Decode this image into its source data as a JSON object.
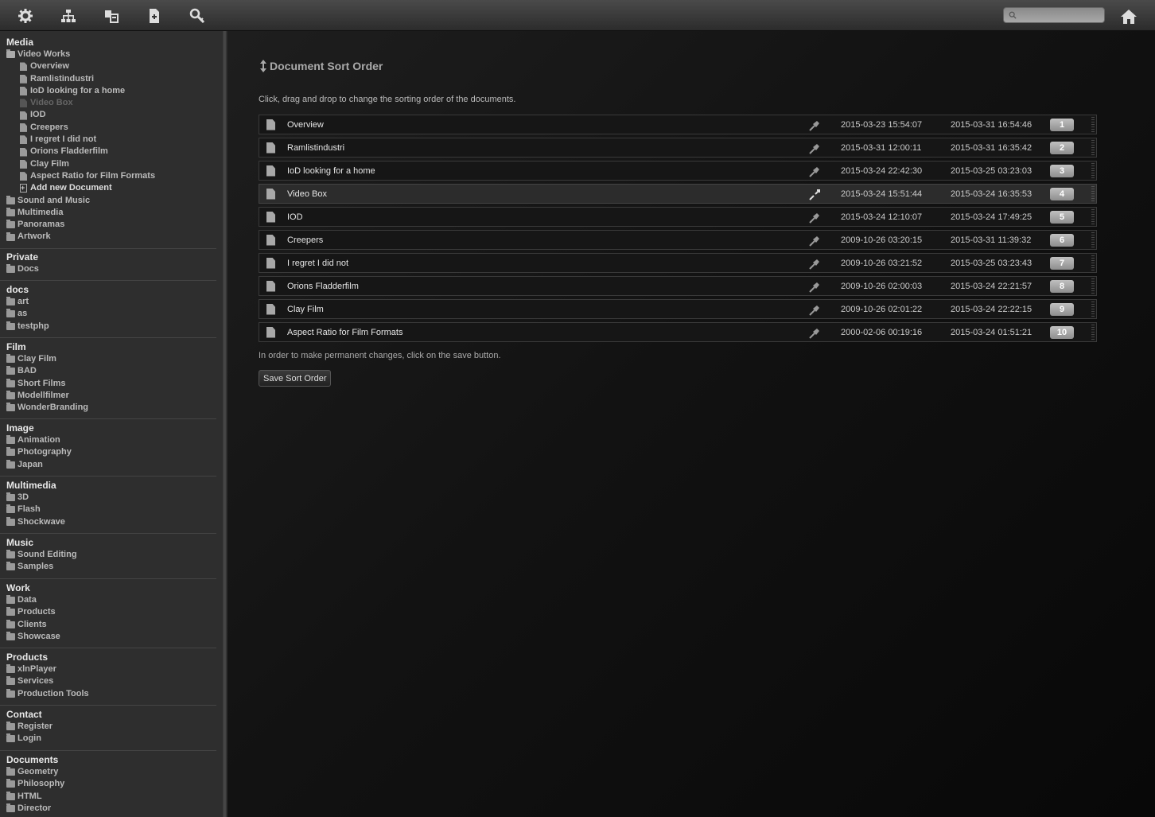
{
  "toolbar": {
    "icons": [
      "gear-icon",
      "sitemap-icon",
      "copy-icon",
      "new-document-icon",
      "search-key-icon"
    ],
    "search_placeholder": "",
    "home_icon": "home-icon"
  },
  "sidebar": {
    "sections": [
      {
        "title": "Media",
        "items": [
          {
            "label": "Video Works",
            "type": "folder-open",
            "children": [
              {
                "label": "Overview",
                "state": "normal"
              },
              {
                "label": "Ramlistindustri",
                "state": "normal"
              },
              {
                "label": "IoD looking for a home",
                "state": "normal"
              },
              {
                "label": "Video Box",
                "state": "dim"
              },
              {
                "label": "IOD",
                "state": "normal"
              },
              {
                "label": "Creepers",
                "state": "normal"
              },
              {
                "label": "I regret I did not",
                "state": "normal"
              },
              {
                "label": "Orions Fladderfilm",
                "state": "normal"
              },
              {
                "label": "Clay Film",
                "state": "normal"
              },
              {
                "label": "Aspect Ratio for Film Formats",
                "state": "normal"
              },
              {
                "label": "Add new Document",
                "state": "add"
              }
            ]
          },
          {
            "label": "Sound and Music",
            "type": "folder"
          },
          {
            "label": "Multimedia",
            "type": "folder"
          },
          {
            "label": "Panoramas",
            "type": "folder"
          },
          {
            "label": "Artwork",
            "type": "folder"
          }
        ]
      },
      {
        "title": "Private",
        "items": [
          {
            "label": "Docs",
            "type": "folder"
          }
        ]
      },
      {
        "title": "docs",
        "items": [
          {
            "label": "art",
            "type": "folder"
          },
          {
            "label": "as",
            "type": "folder"
          },
          {
            "label": "testphp",
            "type": "folder"
          }
        ]
      },
      {
        "title": "Film",
        "items": [
          {
            "label": "Clay Film",
            "type": "folder"
          },
          {
            "label": "BAD",
            "type": "folder"
          },
          {
            "label": "Short Films",
            "type": "folder"
          },
          {
            "label": "Modellfilmer",
            "type": "folder"
          },
          {
            "label": "WonderBranding",
            "type": "folder"
          }
        ]
      },
      {
        "title": "Image",
        "items": [
          {
            "label": "Animation",
            "type": "folder"
          },
          {
            "label": "Photography",
            "type": "folder"
          },
          {
            "label": "Japan",
            "type": "folder"
          }
        ]
      },
      {
        "title": "Multimedia",
        "items": [
          {
            "label": "3D",
            "type": "folder"
          },
          {
            "label": "Flash",
            "type": "folder"
          },
          {
            "label": "Shockwave",
            "type": "folder"
          }
        ]
      },
      {
        "title": "Music",
        "items": [
          {
            "label": "Sound Editing",
            "type": "folder"
          },
          {
            "label": "Samples",
            "type": "folder"
          }
        ]
      },
      {
        "title": "Work",
        "items": [
          {
            "label": "Data",
            "type": "folder"
          },
          {
            "label": "Products",
            "type": "folder"
          },
          {
            "label": "Clients",
            "type": "folder"
          },
          {
            "label": "Showcase",
            "type": "folder"
          }
        ]
      },
      {
        "title": "Products",
        "items": [
          {
            "label": "xlnPlayer",
            "type": "folder"
          },
          {
            "label": "Services",
            "type": "folder"
          },
          {
            "label": "Production Tools",
            "type": "folder"
          }
        ]
      },
      {
        "title": "Contact",
        "items": [
          {
            "label": "Register",
            "type": "folder"
          },
          {
            "label": "Login",
            "type": "folder"
          }
        ]
      },
      {
        "title": "Documents",
        "items": [
          {
            "label": "Geometry",
            "type": "folder"
          },
          {
            "label": "Philosophy",
            "type": "folder"
          },
          {
            "label": "HTML",
            "type": "folder"
          },
          {
            "label": "Director",
            "type": "folder"
          }
        ]
      }
    ]
  },
  "main": {
    "heading": "Document Sort Order",
    "intro": "Click, drag and drop to change the sorting order of the documents.",
    "documents": [
      {
        "title": "Overview",
        "created": "2015-03-23 15:54:07",
        "modified": "2015-03-31 16:54:46",
        "order": "1",
        "selected": false
      },
      {
        "title": "Ramlistindustri",
        "created": "2015-03-31 12:00:11",
        "modified": "2015-03-31 16:35:42",
        "order": "2",
        "selected": false
      },
      {
        "title": "IoD looking for a home",
        "created": "2015-03-24 22:42:30",
        "modified": "2015-03-25 03:23:03",
        "order": "3",
        "selected": false
      },
      {
        "title": "Video Box",
        "created": "2015-03-24 15:51:44",
        "modified": "2015-03-24 16:35:53",
        "order": "4",
        "selected": true
      },
      {
        "title": "IOD",
        "created": "2015-03-24 12:10:07",
        "modified": "2015-03-24 17:49:25",
        "order": "5",
        "selected": false
      },
      {
        "title": "Creepers",
        "created": "2009-10-26 03:20:15",
        "modified": "2015-03-31 11:39:32",
        "order": "6",
        "selected": false
      },
      {
        "title": "I regret I did not",
        "created": "2009-10-26 03:21:52",
        "modified": "2015-03-25 03:23:43",
        "order": "7",
        "selected": false
      },
      {
        "title": "Orions Fladderfilm",
        "created": "2009-10-26 02:00:03",
        "modified": "2015-03-24 22:21:57",
        "order": "8",
        "selected": false
      },
      {
        "title": "Clay Film",
        "created": "2009-10-26 02:01:22",
        "modified": "2015-03-24 22:22:15",
        "order": "9",
        "selected": false
      },
      {
        "title": "Aspect Ratio for Film Formats",
        "created": "2000-02-06 00:19:16",
        "modified": "2015-03-24 01:51:21",
        "order": "10",
        "selected": false
      }
    ],
    "note": "In order to make permanent changes, click on the save button.",
    "save_label": "Save Sort Order"
  }
}
